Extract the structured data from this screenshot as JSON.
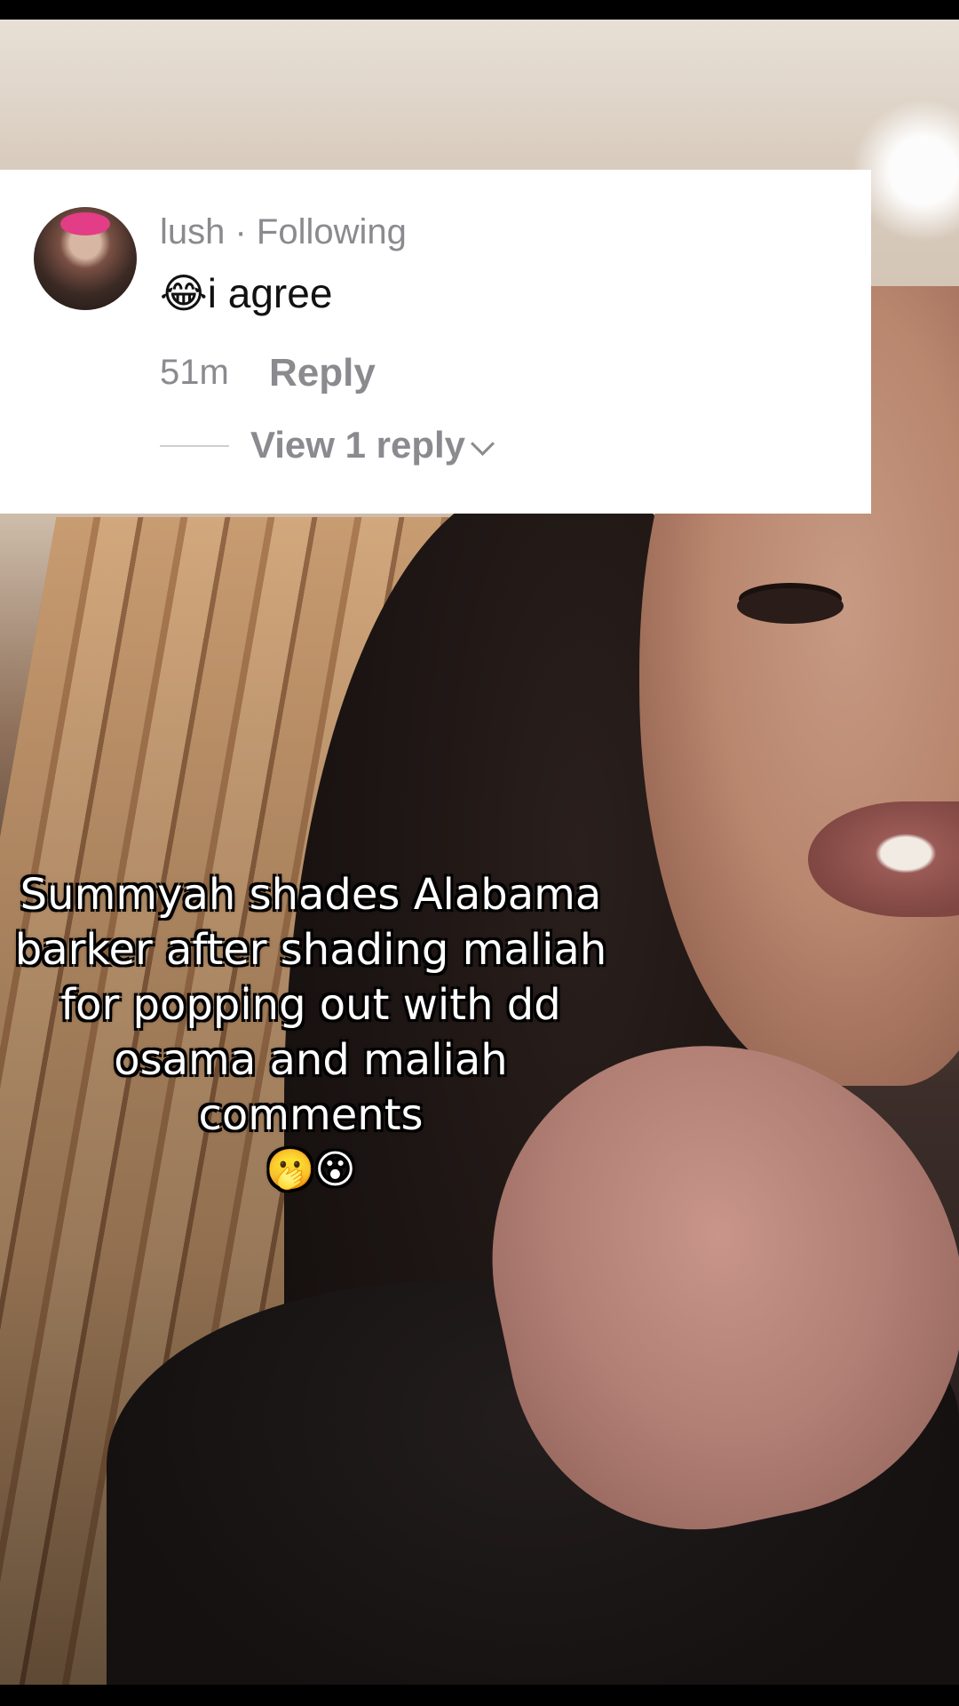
{
  "comment": {
    "username_line": "lush · Following",
    "text_emoji": "😂",
    "text": "i agree",
    "time": "51m",
    "reply_label": "Reply",
    "view_replies_label": "View 1 reply"
  },
  "caption": {
    "lines": [
      "Summyah shades Alabama",
      "barker after shading maliah",
      "for popping out with dd",
      "osama and maliah comments"
    ],
    "emojis": "🫢😮"
  }
}
